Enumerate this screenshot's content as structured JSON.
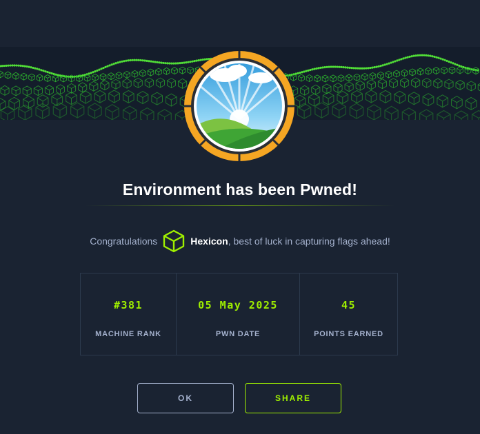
{
  "dialog": {
    "title": "Environment has been Pwned!",
    "congrats_prefix": "Congratulations",
    "username": "Hexicon",
    "congrats_suffix": ", best of luck in capturing flags ahead!"
  },
  "stats": [
    {
      "value": "#381",
      "label": "MACHINE RANK"
    },
    {
      "value": "05 May 2025",
      "label": "PWN DATE"
    },
    {
      "value": "45",
      "label": "POINTS EARNED"
    }
  ],
  "buttons": {
    "ok": "OK",
    "share": "SHARE"
  },
  "colors": {
    "background": "#1a2332",
    "accent": "#9fef00",
    "muted": "#a4b1cd",
    "badge_ring": "#f5a623"
  },
  "icons": {
    "badge": "machine-badge-landscape-icon",
    "user": "htb-cube-icon"
  }
}
